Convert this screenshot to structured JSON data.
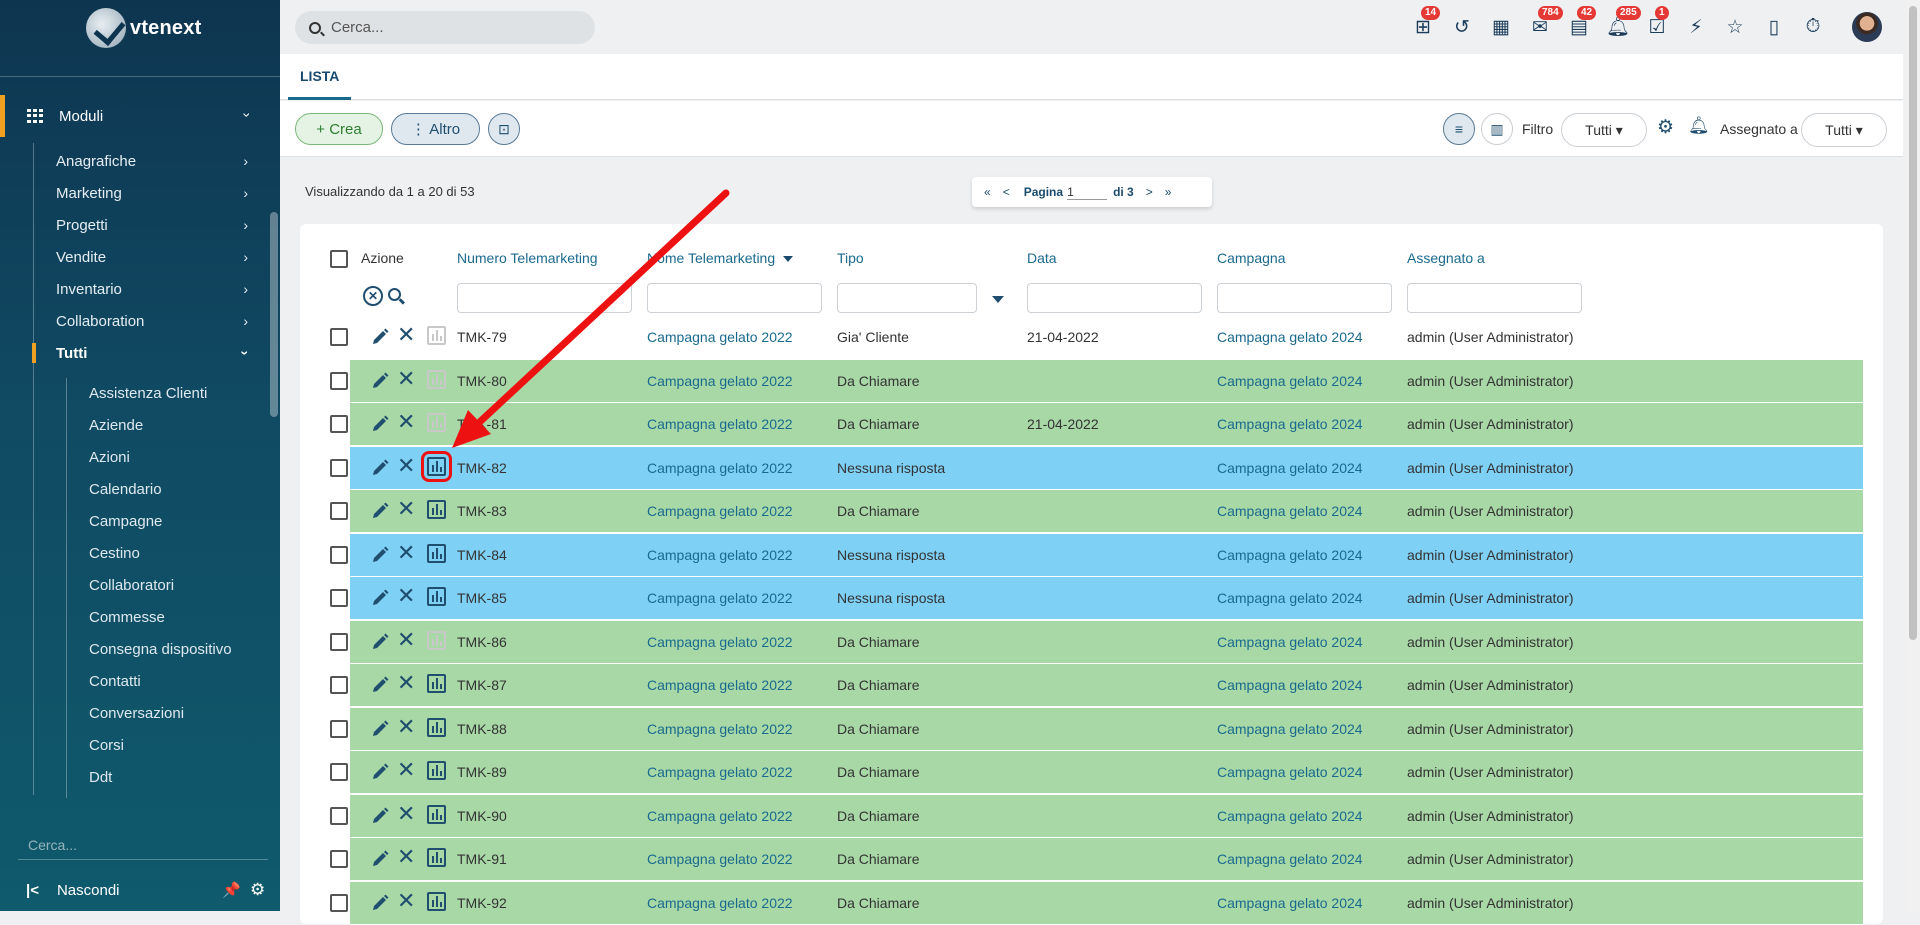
{
  "brand": {
    "name": "vtenext"
  },
  "sidebar": {
    "module_label": "Moduli",
    "categories": [
      {
        "label": "Anagrafiche"
      },
      {
        "label": "Marketing"
      },
      {
        "label": "Progetti"
      },
      {
        "label": "Vendite"
      },
      {
        "label": "Inventario"
      },
      {
        "label": "Collaboration"
      },
      {
        "label": "Tutti"
      }
    ],
    "items": [
      {
        "label": "Assistenza Clienti"
      },
      {
        "label": "Aziende"
      },
      {
        "label": "Azioni"
      },
      {
        "label": "Calendario"
      },
      {
        "label": "Campagne"
      },
      {
        "label": "Cestino"
      },
      {
        "label": "Collaboratori"
      },
      {
        "label": "Commesse"
      },
      {
        "label": "Consegna dispositivo"
      },
      {
        "label": "Contatti"
      },
      {
        "label": "Conversazioni"
      },
      {
        "label": "Corsi"
      },
      {
        "label": "Ddt"
      }
    ],
    "search_placeholder": "Cerca...",
    "hide_label": "Nascondi"
  },
  "topbar": {
    "search_placeholder": "Cerca...",
    "badges": {
      "processes": "14",
      "mail": "784",
      "messages": "42",
      "notifications": "285",
      "todos": "1"
    }
  },
  "tabs": {
    "list": "LISTA"
  },
  "toolbar": {
    "create_label": "+ Crea",
    "more_label": "⋮ Altro",
    "filter_label": "Filtro",
    "filter_value": "Tutti",
    "assigned_label": "Assegnato a",
    "assigned_value": "Tutti"
  },
  "list": {
    "summary": "Visualizzando da 1 a 20 di 53",
    "pager": {
      "first": "«",
      "prev": "<",
      "page_label": "Pagina",
      "page_value": "1",
      "of_label": "di 3",
      "next": ">",
      "last": "»"
    },
    "columns": {
      "action": "Azione",
      "number": "Numero Telemarketing",
      "name": "Nome Telemarketing",
      "type": "Tipo",
      "date": "Data",
      "campaign": "Campagna",
      "assigned": "Assegnato a"
    },
    "rows": [
      {
        "number": "TMK-79",
        "name": "Campagna gelato 2022",
        "type": "Gia' Cliente",
        "date": "21-04-2022",
        "campaign": "Campagna gelato 2024",
        "assigned": "admin (User Administrator)",
        "color": "none",
        "chart_enabled": false
      },
      {
        "number": "TMK-80",
        "name": "Campagna gelato 2022",
        "type": "Da Chiamare",
        "date": "",
        "campaign": "Campagna gelato 2024",
        "assigned": "admin (User Administrator)",
        "color": "green",
        "chart_enabled": false
      },
      {
        "number": "TMK-81",
        "name": "Campagna gelato 2022",
        "type": "Da Chiamare",
        "date": "21-04-2022",
        "campaign": "Campagna gelato 2024",
        "assigned": "admin (User Administrator)",
        "color": "green",
        "chart_enabled": false
      },
      {
        "number": "TMK-82",
        "name": "Campagna gelato 2022",
        "type": "Nessuna risposta",
        "date": "",
        "campaign": "Campagna gelato 2024",
        "assigned": "admin (User Administrator)",
        "color": "blue",
        "chart_enabled": true,
        "highlight": true
      },
      {
        "number": "TMK-83",
        "name": "Campagna gelato 2022",
        "type": "Da Chiamare",
        "date": "",
        "campaign": "Campagna gelato 2024",
        "assigned": "admin (User Administrator)",
        "color": "green",
        "chart_enabled": true
      },
      {
        "number": "TMK-84",
        "name": "Campagna gelato 2022",
        "type": "Nessuna risposta",
        "date": "",
        "campaign": "Campagna gelato 2024",
        "assigned": "admin (User Administrator)",
        "color": "blue",
        "chart_enabled": true
      },
      {
        "number": "TMK-85",
        "name": "Campagna gelato 2022",
        "type": "Nessuna risposta",
        "date": "",
        "campaign": "Campagna gelato 2024",
        "assigned": "admin (User Administrator)",
        "color": "blue",
        "chart_enabled": true
      },
      {
        "number": "TMK-86",
        "name": "Campagna gelato 2022",
        "type": "Da Chiamare",
        "date": "",
        "campaign": "Campagna gelato 2024",
        "assigned": "admin (User Administrator)",
        "color": "green",
        "chart_enabled": false
      },
      {
        "number": "TMK-87",
        "name": "Campagna gelato 2022",
        "type": "Da Chiamare",
        "date": "",
        "campaign": "Campagna gelato 2024",
        "assigned": "admin (User Administrator)",
        "color": "green",
        "chart_enabled": true
      },
      {
        "number": "TMK-88",
        "name": "Campagna gelato 2022",
        "type": "Da Chiamare",
        "date": "",
        "campaign": "Campagna gelato 2024",
        "assigned": "admin (User Administrator)",
        "color": "green",
        "chart_enabled": true
      },
      {
        "number": "TMK-89",
        "name": "Campagna gelato 2022",
        "type": "Da Chiamare",
        "date": "",
        "campaign": "Campagna gelato 2024",
        "assigned": "admin (User Administrator)",
        "color": "green",
        "chart_enabled": true
      },
      {
        "number": "TMK-90",
        "name": "Campagna gelato 2022",
        "type": "Da Chiamare",
        "date": "",
        "campaign": "Campagna gelato 2024",
        "assigned": "admin (User Administrator)",
        "color": "green",
        "chart_enabled": true
      },
      {
        "number": "TMK-91",
        "name": "Campagna gelato 2022",
        "type": "Da Chiamare",
        "date": "",
        "campaign": "Campagna gelato 2024",
        "assigned": "admin (User Administrator)",
        "color": "green",
        "chart_enabled": true
      },
      {
        "number": "TMK-92",
        "name": "Campagna gelato 2022",
        "type": "Da Chiamare",
        "date": "",
        "campaign": "Campagna gelato 2024",
        "assigned": "admin (User Administrator)",
        "color": "green",
        "chart_enabled": true
      }
    ]
  },
  "colors": {
    "sidebar": "#0e3550",
    "accent": "#f0a020",
    "row_green": "#a8d8a6",
    "row_blue": "#7fd0f5",
    "link": "#1a6a8e",
    "annotation": "#e11111"
  }
}
